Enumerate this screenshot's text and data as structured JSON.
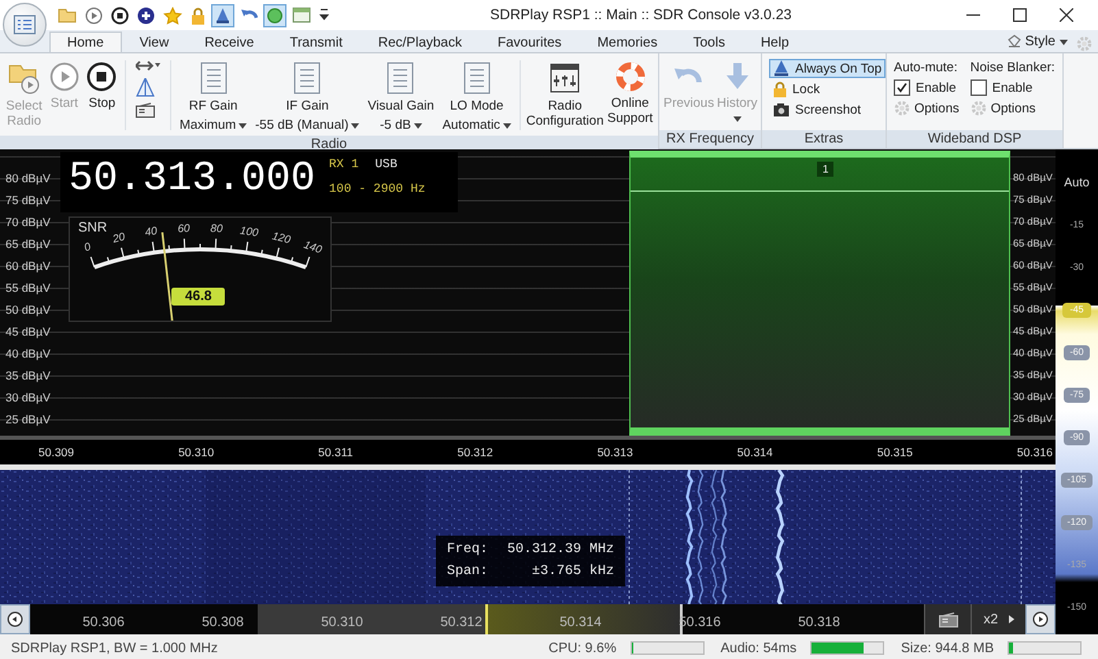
{
  "window": {
    "title": "SDRPlay RSP1 :: Main :: SDR Console v3.0.23"
  },
  "quick_access": [
    {
      "kind": "folder",
      "on": false
    },
    {
      "kind": "play",
      "on": false
    },
    {
      "kind": "stop",
      "on": false
    },
    {
      "kind": "add",
      "on": false
    },
    {
      "kind": "star",
      "on": false
    },
    {
      "kind": "lock",
      "on": false
    },
    {
      "kind": "pin",
      "on": true
    },
    {
      "kind": "undo",
      "on": false
    },
    {
      "kind": "circle",
      "on": true
    },
    {
      "kind": "window",
      "on": false
    },
    {
      "kind": "more",
      "on": false
    }
  ],
  "tabs": [
    {
      "label": "Home",
      "selected": true
    },
    {
      "label": "View",
      "selected": false
    },
    {
      "label": "Receive",
      "selected": false
    },
    {
      "label": "Transmit",
      "selected": false
    },
    {
      "label": "Rec/Playback",
      "selected": false
    },
    {
      "label": "Favourites",
      "selected": false
    },
    {
      "label": "Memories",
      "selected": false
    },
    {
      "label": "Tools",
      "selected": false
    },
    {
      "label": "Help",
      "selected": false
    }
  ],
  "style_menu": {
    "label": "Style"
  },
  "radio_group": {
    "title": "Radio",
    "buttons": [
      {
        "label": "Select Radio",
        "disabled": true
      },
      {
        "label": "Start",
        "disabled": true
      },
      {
        "label": "Stop",
        "disabled": false
      }
    ],
    "gains": [
      {
        "label": "RF Gain",
        "value": "Maximum"
      },
      {
        "label": "IF Gain",
        "value": "-55 dB (Manual)"
      },
      {
        "label": "Visual Gain",
        "value": "-5 dB"
      },
      {
        "label": "LO Mode",
        "value": "Automatic"
      }
    ],
    "links": [
      {
        "label": "Radio Configuration"
      },
      {
        "label": "Online Support"
      }
    ]
  },
  "rx_frequency": {
    "title": "RX Frequency",
    "buttons": [
      {
        "label": "Previous",
        "disabled": true
      },
      {
        "label": "History",
        "disabled": true
      }
    ]
  },
  "extras": {
    "title": "Extras",
    "items": [
      {
        "label": "Always On Top",
        "on": true
      },
      {
        "label": "Lock",
        "on": false
      },
      {
        "label": "Screenshot",
        "on": false
      }
    ]
  },
  "wideband_dsp": {
    "title": "Wideband DSP",
    "columns": [
      {
        "heading": "Auto-mute:",
        "check_label": "Enable",
        "checked": true,
        "options": "Options"
      },
      {
        "heading": "Noise Blanker:",
        "check_label": "Enable",
        "checked": false,
        "options": "Options"
      }
    ]
  },
  "receiver": {
    "frequency": "50.313.000",
    "rx": "RX 1",
    "mode": "USB",
    "bandwidth": "100 - 2900 Hz"
  },
  "snr_meter": {
    "label": "SNR",
    "ticks": [
      "0",
      "20",
      "40",
      "60",
      "80",
      "100",
      "120",
      "140"
    ],
    "level": 0.334,
    "reading": "46.8"
  },
  "spectrum": {
    "left_scale": [
      "80 dBµV",
      "75 dBµV",
      "70 dBµV",
      "65 dBµV",
      "60 dBµV",
      "55 dBµV",
      "50 dBµV",
      "45 dBµV",
      "40 dBµV",
      "35 dBµV",
      "30 dBµV",
      "25 dBµV"
    ],
    "right_scale": [
      "80 dBµV",
      "75 dBµV",
      "70 dBµV",
      "65 dBµV",
      "60 dBµV",
      "55 dBµV",
      "50 dBµV",
      "45 dBµV",
      "40 dBµV",
      "35 dBµV",
      "30 dBµV",
      "25 dBµV"
    ],
    "passband": {
      "label": "1"
    },
    "freq_axis": [
      "50.309",
      "50.310",
      "50.311",
      "50.312",
      "50.313",
      "50.314",
      "50.315",
      "50.316"
    ]
  },
  "waterfall": {
    "tooltip": {
      "freq_label": "Freq:",
      "freq": "50.312.39 MHz",
      "span_label": "Span:",
      "span": "±3.765 kHz"
    }
  },
  "overview": {
    "labels": [
      "50.306",
      "50.308",
      "50.310",
      "50.312",
      "50.314",
      "50.316",
      "50.318"
    ],
    "zoom": "x2"
  },
  "level_scale": {
    "mode": "Auto",
    "marks": [
      {
        "label": "-15",
        "kind": "plain"
      },
      {
        "label": "-30",
        "kind": "plain"
      },
      {
        "label": "-45",
        "kind": "active"
      },
      {
        "label": "-60",
        "kind": "chip"
      },
      {
        "label": "-75",
        "kind": "chip"
      },
      {
        "label": "-90",
        "kind": "chip"
      },
      {
        "label": "-105",
        "kind": "chip"
      },
      {
        "label": "-120",
        "kind": "chip"
      },
      {
        "label": "-135",
        "kind": "plain"
      },
      {
        "label": "-150",
        "kind": "plain"
      }
    ]
  },
  "status_bar": {
    "device": "SDRPlay RSP1, BW = 1.000 MHz",
    "meters": [
      {
        "label": "CPU: 9.6%",
        "level": 0.03
      },
      {
        "label": "Audio: 54ms",
        "level": 0.72
      },
      {
        "label": "Size: 944.8 MB",
        "level": 0.05
      }
    ]
  }
}
